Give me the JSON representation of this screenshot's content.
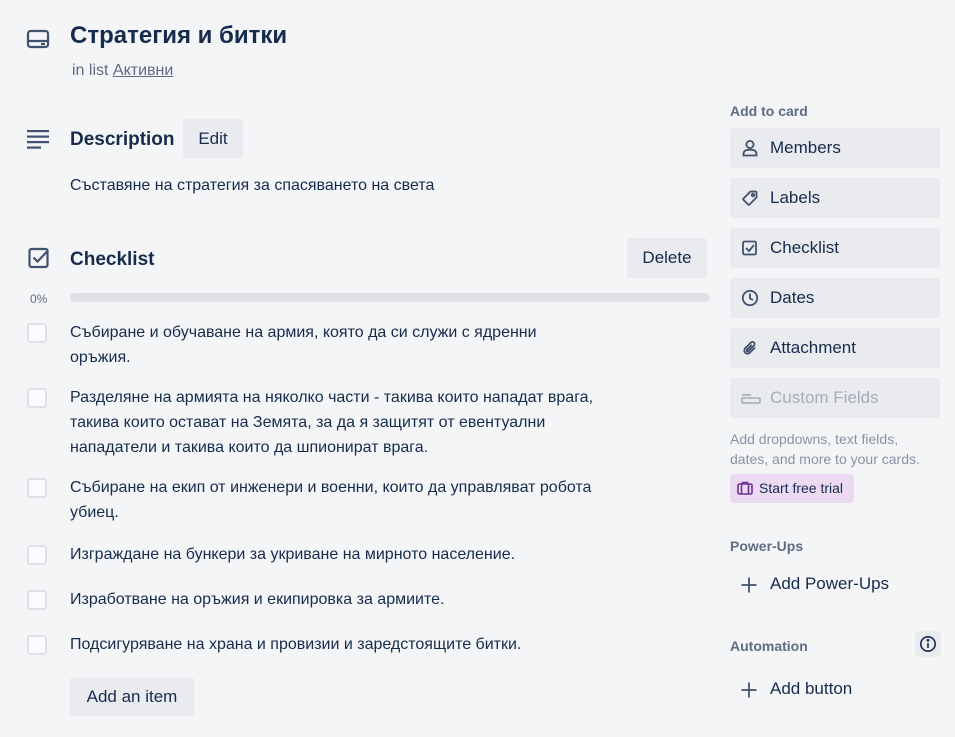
{
  "card": {
    "title": "Стратегия и битки",
    "in_list_prefix": "in list",
    "list_name": "Активни"
  },
  "description": {
    "heading": "Description",
    "edit_label": "Edit",
    "text": "Съставяне на стратегия за спасяването на света"
  },
  "checklist": {
    "heading": "Checklist",
    "delete_label": "Delete",
    "percent_label": "0%",
    "progress": 0,
    "items": [
      {
        "text": "Събиране и обучаване на армия, която да си служи с ядренни оръжия.",
        "checked": false
      },
      {
        "text": "Разделяне на армията на няколко части - такива които нападат врага, такива които остават на Земята, за да я защитят от евентуални нападатели и такива които да шпионират врага.",
        "checked": false
      },
      {
        "text": "Събиране на екип от инженери и военни, които да управляват робота убиец.",
        "checked": false
      },
      {
        "text": "Изграждане на бункери за укриване на мирното население.",
        "checked": false
      },
      {
        "text": "Изработване на оръжия и екипировка за армиите.",
        "checked": false
      },
      {
        "text": "Подсигуряване на храна и провизии и заредстоящите битки.",
        "checked": false
      }
    ],
    "add_item_label": "Add an item"
  },
  "sidebar": {
    "add_to_card_title": "Add to card",
    "buttons": [
      {
        "label": "Members",
        "icon": "person-icon"
      },
      {
        "label": "Labels",
        "icon": "tag-icon"
      },
      {
        "label": "Checklist",
        "icon": "checkbox-icon"
      },
      {
        "label": "Dates",
        "icon": "clock-icon"
      },
      {
        "label": "Attachment",
        "icon": "paperclip-icon"
      },
      {
        "label": "Custom Fields",
        "icon": "field-icon",
        "disabled": true
      }
    ],
    "custom_fields_hint": "Add dropdowns, text fields, dates, and more to your cards.",
    "trial_label": "Start free trial",
    "powerups_title": "Power-Ups",
    "add_powerups_label": "Add Power-Ups",
    "automation_title": "Automation",
    "add_button_label": "Add button"
  },
  "colors": {
    "background": "#f4f5f7",
    "button_bg": "#e9ebee",
    "text": "#172b4d",
    "muted": "#5e6c84",
    "trial_bg": "#ecdaf3",
    "progress_track": "#dfe1e6"
  }
}
